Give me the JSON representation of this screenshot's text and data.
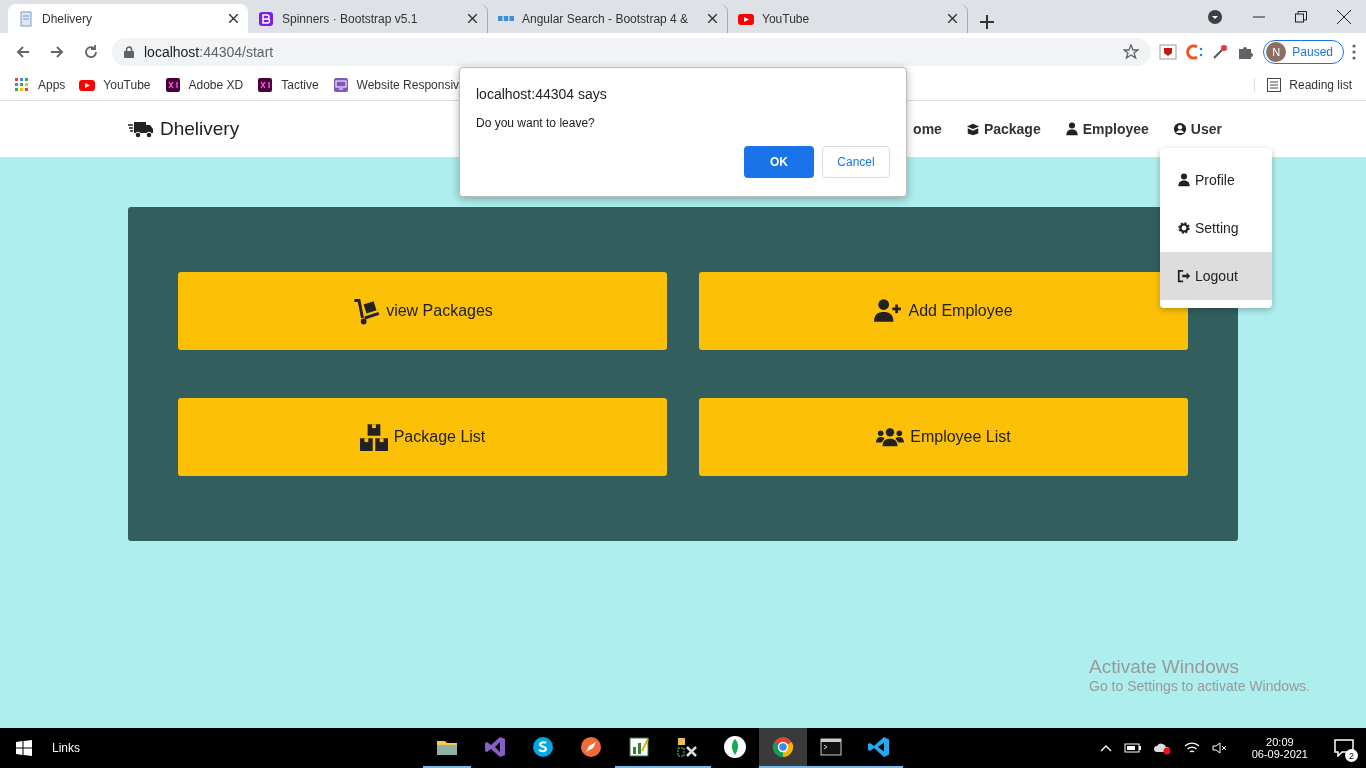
{
  "browser": {
    "tabs": [
      {
        "title": "Dhelivery",
        "kind": "page",
        "selected": true
      },
      {
        "title": "Spinners · Bootstrap v5.1",
        "kind": "bootstrap",
        "selected": false
      },
      {
        "title": "Angular Search - Bootstrap 4 &",
        "kind": "mdb",
        "selected": false
      },
      {
        "title": "YouTube",
        "kind": "youtube",
        "selected": false
      }
    ],
    "address": {
      "host": "localhost",
      "path": ":44304/start"
    },
    "profile": {
      "initial": "N",
      "status": "Paused"
    },
    "bookmarks": [
      {
        "label": "Apps",
        "kind": "apps"
      },
      {
        "label": "YouTube",
        "kind": "youtube"
      },
      {
        "label": "Adobe XD",
        "kind": "xd"
      },
      {
        "label": "Tactive",
        "kind": "xd"
      },
      {
        "label": "Website Responsiv",
        "kind": "monitor"
      }
    ],
    "reading_list": "Reading list"
  },
  "navbar": {
    "brand": "Dhelivery",
    "items": [
      {
        "label": "ome",
        "kind": "none"
      },
      {
        "label": "Package",
        "kind": "box"
      },
      {
        "label": "Employee",
        "kind": "person"
      },
      {
        "label": "User",
        "kind": "user-circle"
      }
    ]
  },
  "user_menu": {
    "items": [
      {
        "label": "Profile",
        "kind": "person",
        "selected": false
      },
      {
        "label": "Setting",
        "kind": "gear",
        "selected": false
      },
      {
        "label": "Logout",
        "kind": "logout",
        "selected": true
      }
    ]
  },
  "tiles": [
    {
      "label": "view Packages",
      "kind": "dolly"
    },
    {
      "label": "Add Employee",
      "kind": "user-plus"
    },
    {
      "label": "Package List",
      "kind": "boxes"
    },
    {
      "label": "Employee List",
      "kind": "users"
    }
  ],
  "dialog": {
    "title": "localhost:44304 says",
    "message": "Do you want to leave?",
    "ok": "OK",
    "cancel": "Cancel"
  },
  "activation": {
    "title": "Activate Windows",
    "message": "Go to Settings to activate Windows."
  },
  "taskbar": {
    "links": "Links",
    "apps": [
      {
        "kind": "folder",
        "running": true,
        "active": false
      },
      {
        "kind": "vs",
        "running": false,
        "active": false
      },
      {
        "kind": "skype",
        "running": false,
        "active": false
      },
      {
        "kind": "compass",
        "running": false,
        "active": false
      },
      {
        "kind": "chart",
        "running": true,
        "active": false
      },
      {
        "kind": "tools",
        "running": true,
        "active": false
      },
      {
        "kind": "leaf",
        "running": false,
        "active": false
      },
      {
        "kind": "chrome",
        "running": true,
        "active": true
      },
      {
        "kind": "terminal",
        "running": true,
        "active": false
      },
      {
        "kind": "vscode",
        "running": true,
        "active": false
      }
    ],
    "time": "20:09",
    "date": "06-09-2021",
    "notifications": "2"
  }
}
